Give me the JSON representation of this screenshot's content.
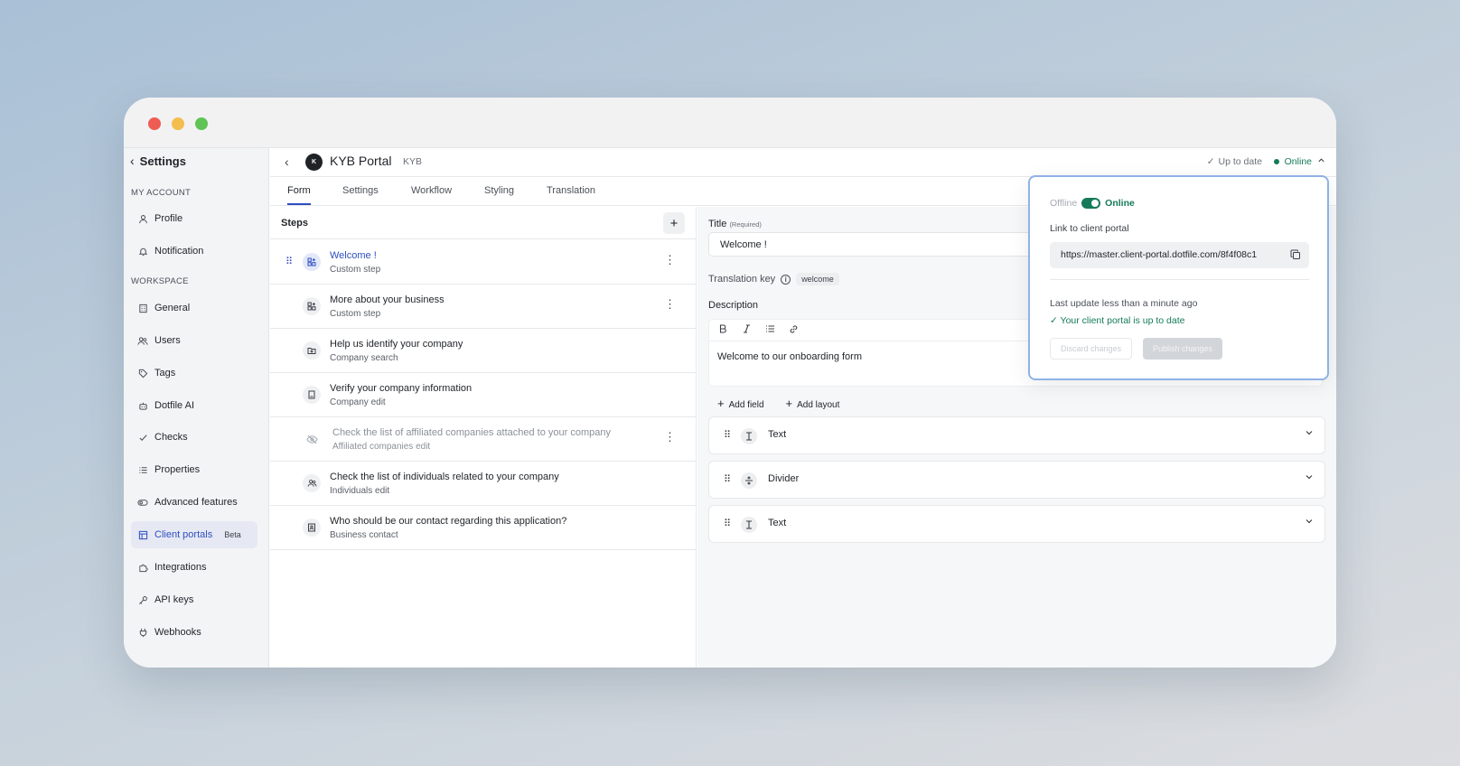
{
  "sidebar": {
    "back_label": "Settings",
    "sections": {
      "account": "MY ACCOUNT",
      "workspace": "WORKSPACE"
    },
    "items": [
      {
        "label": "Profile",
        "icon": "user-icon"
      },
      {
        "label": "Notification",
        "icon": "bell-icon"
      },
      {
        "label": "General",
        "icon": "building-icon"
      },
      {
        "label": "Users",
        "icon": "users-icon"
      },
      {
        "label": "Tags",
        "icon": "tag-icon"
      },
      {
        "label": "Dotfile AI",
        "icon": "robot-icon"
      },
      {
        "label": "Checks",
        "icon": "check-icon"
      },
      {
        "label": "Properties",
        "icon": "list-icon"
      },
      {
        "label": "Advanced features",
        "icon": "toggle-icon"
      },
      {
        "label": "Client portals",
        "icon": "layout-icon",
        "badge": "Beta",
        "active": true
      },
      {
        "label": "Integrations",
        "icon": "puzzle-icon"
      },
      {
        "label": "API keys",
        "icon": "key-icon"
      },
      {
        "label": "Webhooks",
        "icon": "plug-icon"
      }
    ]
  },
  "header": {
    "logo_letter": "K",
    "title": "KYB Portal",
    "tag": "KYB",
    "sync_status": "Up to date",
    "online_status": "Online"
  },
  "tabs": [
    "Form",
    "Settings",
    "Workflow",
    "Styling",
    "Translation"
  ],
  "steps": {
    "title": "Steps",
    "items": [
      {
        "title": "Welcome !",
        "subtitle": "Custom step"
      },
      {
        "title": "More about your business",
        "subtitle": "Custom step"
      },
      {
        "title": "Help us identify your company",
        "subtitle": "Company search"
      },
      {
        "title": "Verify your company information",
        "subtitle": "Company edit"
      },
      {
        "title": "Check the list of affiliated companies attached to your company",
        "subtitle": "Affiliated companies edit"
      },
      {
        "title": "Check the list of individuals related to your company",
        "subtitle": "Individuals edit"
      },
      {
        "title": "Who should be our contact regarding this application?",
        "subtitle": "Business contact"
      }
    ]
  },
  "editor": {
    "title_label": "Title",
    "title_required": "(Required)",
    "title_value": "Welcome !",
    "translation_key_label": "Translation key",
    "translation_key_value": "welcome",
    "description_label": "Description",
    "description_value": "Welcome to our onboarding form",
    "add_field": "Add field",
    "add_layout": "Add layout",
    "fields": [
      {
        "label": "Text",
        "icon": "text-cursor-icon"
      },
      {
        "label": "Divider",
        "icon": "divider-icon"
      },
      {
        "label": "Text",
        "icon": "text-cursor-icon"
      }
    ]
  },
  "popover": {
    "offline_label": "Offline",
    "online_label": "Online",
    "link_label": "Link to client portal",
    "url": "https://master.client-portal.dotfile.com/8f4f08c1",
    "last_update": "Last update less than a minute ago",
    "status": "Your client portal is up to date",
    "discard": "Discard changes",
    "publish": "Publish changes"
  },
  "colors": {
    "accent": "#2f4ec0",
    "online": "#147a5a"
  }
}
